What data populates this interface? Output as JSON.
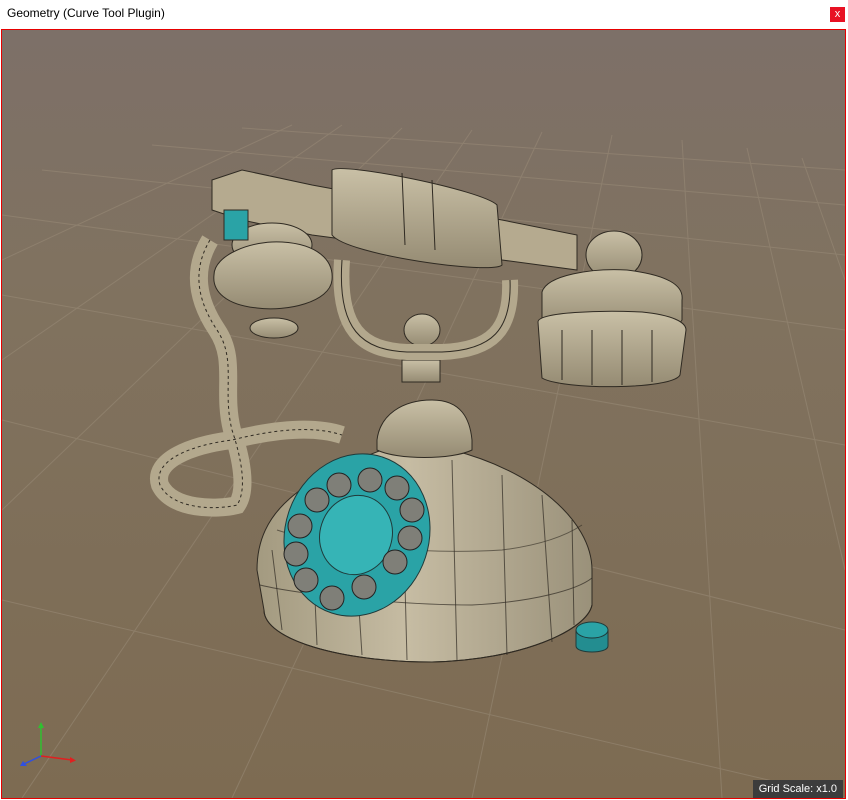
{
  "window": {
    "title": "Geometry (Curve Tool Plugin)",
    "close_label": "x"
  },
  "viewport": {
    "grid_scale_text": "Grid Scale: x1.0"
  },
  "colors": {
    "viewport_border": "#e60000",
    "close_button": "#e81123",
    "mesh_fill": "#b5aa8f",
    "dial_accent": "#2aa3a6",
    "axis_x": "#e02020",
    "axis_y": "#30c030",
    "axis_z": "#3050e0"
  },
  "icons": {
    "axis_gizmo": "xyz-axis-icon",
    "close": "close-icon"
  }
}
